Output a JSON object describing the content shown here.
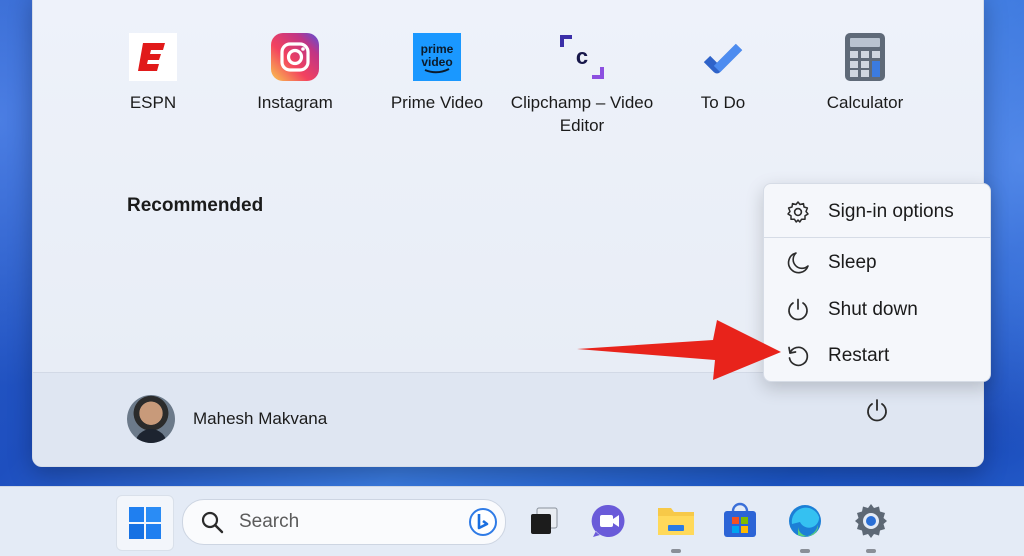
{
  "start_menu": {
    "pinned_apps": [
      {
        "label": "ESPN",
        "icon": "espn-icon"
      },
      {
        "label": "Instagram",
        "icon": "instagram-icon"
      },
      {
        "label": "Prime Video",
        "icon": "prime-video-icon",
        "icon_text_1": "prime",
        "icon_text_2": "video"
      },
      {
        "label": "Clipchamp – Video Editor",
        "icon": "clipchamp-icon",
        "icon_text": "c"
      },
      {
        "label": "To Do",
        "icon": "todo-icon"
      },
      {
        "label": "Calculator",
        "icon": "calculator-icon"
      }
    ],
    "recommended_heading": "Recommended",
    "user": {
      "name": "Mahesh Makvana"
    },
    "power_icon": "power-icon"
  },
  "power_menu": {
    "items": [
      {
        "label": "Sign-in options",
        "icon": "gear-icon"
      },
      {
        "label": "Sleep",
        "icon": "moon-icon"
      },
      {
        "label": "Shut down",
        "icon": "power-icon"
      },
      {
        "label": "Restart",
        "icon": "restart-icon"
      }
    ]
  },
  "annotation": {
    "arrow_color": "#e8231b"
  },
  "taskbar": {
    "search": {
      "placeholder": "Search"
    },
    "apps": [
      {
        "name": "start",
        "icon": "windows-icon"
      },
      {
        "name": "task-view",
        "icon": "task-view-icon"
      },
      {
        "name": "meet",
        "icon": "meet-icon"
      },
      {
        "name": "file-explorer",
        "icon": "folder-icon"
      },
      {
        "name": "store",
        "icon": "store-icon"
      },
      {
        "name": "edge",
        "icon": "edge-icon"
      },
      {
        "name": "settings",
        "icon": "settings-icon"
      }
    ]
  }
}
